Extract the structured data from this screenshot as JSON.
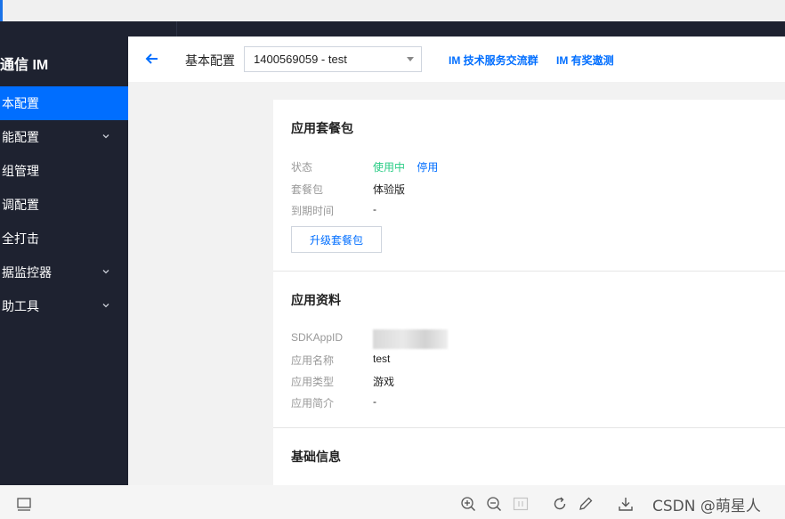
{
  "sidebar": {
    "brand": "通信 IM",
    "items": [
      {
        "label": "本配置",
        "active": true,
        "expandable": false
      },
      {
        "label": "能配置",
        "active": false,
        "expandable": true
      },
      {
        "label": "组管理",
        "active": false,
        "expandable": false
      },
      {
        "label": "调配置",
        "active": false,
        "expandable": false
      },
      {
        "label": "全打击",
        "active": false,
        "expandable": false
      },
      {
        "label": "据监控器",
        "active": false,
        "expandable": true
      },
      {
        "label": "助工具",
        "active": false,
        "expandable": true
      }
    ]
  },
  "header": {
    "title": "基本配置",
    "app_select": "1400569059 - test",
    "links": [
      "IM 技术服务交流群",
      "IM 有奖遨测"
    ]
  },
  "package_section": {
    "title": "应用套餐包",
    "status_label": "状态",
    "status_value": "使用中",
    "disable_link": "停用",
    "package_label": "套餐包",
    "package_value": "体验版",
    "expiry_label": "到期时间",
    "expiry_value": "-",
    "upgrade_button": "升级套餐包"
  },
  "app_info_section": {
    "title": "应用资料",
    "sdkappid_label": "SDKAppID",
    "name_label": "应用名称",
    "name_value": "test",
    "type_label": "应用类型",
    "type_value": "游戏",
    "intro_label": "应用简介",
    "intro_value": "-"
  },
  "basic_info_section": {
    "title": "基础信息"
  },
  "watermark": "CSDN @萌星人",
  "colors": {
    "sidebar_bg": "#1e2230",
    "accent": "#006eff",
    "status_green": "#29cc85"
  }
}
